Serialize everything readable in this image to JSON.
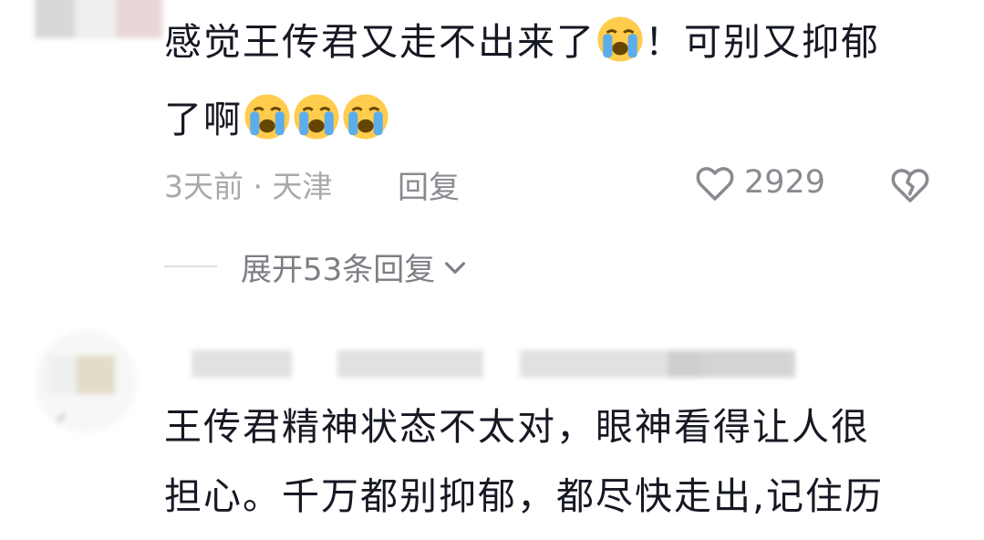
{
  "comment1": {
    "text_line1": "感觉王传君又走不出来了",
    "text_line1_after": "！可别又抑郁",
    "text_line2": "了啊",
    "meta": "3天前 · 天津",
    "reply_label": "回复",
    "like_count": "2929",
    "emoji": "loudly-crying-face",
    "icons": {
      "like": "heart-outline-icon",
      "dislike": "broken-heart-icon"
    }
  },
  "thread": {
    "expand_label": "展开53条回复"
  },
  "comment2": {
    "text_line1": "王传君精神状态不太对，眼神看得让人很",
    "text_line2": "担心。千万都别抑郁，都尽快走出,记住历"
  },
  "colors": {
    "text": "#161823",
    "meta": "#a8a9ad",
    "action": "#8a8b91",
    "emoji_face": "#ffcc4d",
    "emoji_tear": "#5dadec"
  }
}
